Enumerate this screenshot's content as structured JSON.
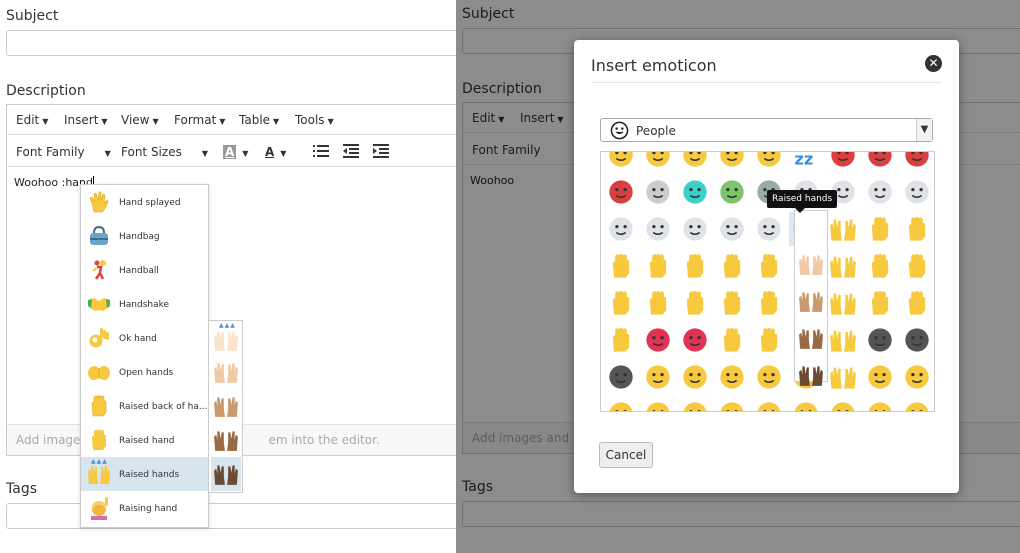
{
  "left": {
    "subject_label": "Subject",
    "description_label": "Description",
    "tags_label": "Tags",
    "menu": [
      "Edit",
      "Insert",
      "View",
      "Format",
      "Table",
      "Tools"
    ],
    "toolbar": {
      "font_family": "Font Family",
      "font_sizes": "Font Sizes",
      "bg_color_letter": "A",
      "text_color_letter": "A"
    },
    "editor_text": "Woohoo :hand",
    "status_prefix": "Add images",
    "status_suffix": "em into the editor.",
    "autocomplete": [
      {
        "label": "Hand splayed",
        "icon": "hand-splayed"
      },
      {
        "label": "Handbag",
        "icon": "handbag"
      },
      {
        "label": "Handball",
        "icon": "handball"
      },
      {
        "label": "Handshake",
        "icon": "handshake"
      },
      {
        "label": "Ok hand",
        "icon": "ok-hand"
      },
      {
        "label": "Open hands",
        "icon": "open-hands"
      },
      {
        "label": "Raised back of ha...",
        "icon": "raised-back-of-hand"
      },
      {
        "label": "Raised hand",
        "icon": "raised-hand"
      },
      {
        "label": "Raised hands",
        "icon": "raised-hands"
      },
      {
        "label": "Raising hand",
        "icon": "raising-hand"
      }
    ],
    "selected_index": 8
  },
  "right": {
    "subject_label": "Subject",
    "description_label": "Description",
    "tags_label": "Tags",
    "menu": [
      "Edit",
      "Insert"
    ],
    "font_family": "Font Family",
    "editor_text": "Woohoo",
    "status_text": "Add images and ot",
    "modal": {
      "title": "Insert emoticon",
      "close_glyph": "✕",
      "category": "People",
      "tooltip": "Raised hands",
      "cancel_label": "Cancel"
    }
  },
  "colors": {
    "emoji_yellow": "#f7c93e",
    "selection": "#d7e6ee",
    "overlay": "#000000"
  }
}
